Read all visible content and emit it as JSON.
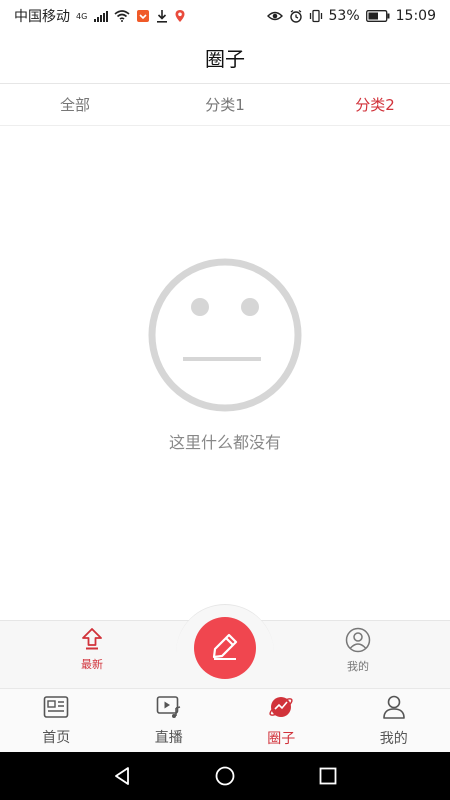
{
  "status_bar": {
    "carrier": "中国移动",
    "network": "4G",
    "battery": "53%",
    "time": "15:09"
  },
  "header": {
    "title": "圈子"
  },
  "tabs": [
    {
      "label": "全部",
      "active": false
    },
    {
      "label": "分类1",
      "active": false
    },
    {
      "label": "分类2",
      "active": true
    }
  ],
  "empty_state": {
    "message": "这里什么都没有",
    "icon": "neutral-face-icon"
  },
  "sub_bar": {
    "left": {
      "label": "最新",
      "icon": "arrow-up-icon"
    },
    "center": {
      "icon": "pencil-icon"
    },
    "right": {
      "label": "我的",
      "icon": "user-circle-icon"
    }
  },
  "bottom_nav": [
    {
      "label": "首页",
      "icon": "news-icon",
      "active": false
    },
    {
      "label": "直播",
      "icon": "video-music-icon",
      "active": false
    },
    {
      "label": "圈子",
      "icon": "planet-icon",
      "active": true
    },
    {
      "label": "我的",
      "icon": "user-icon",
      "active": false
    }
  ],
  "colors": {
    "accent": "#d1323a",
    "compose_button": "#f0464f",
    "empty_icon": "#d6d6d6"
  }
}
